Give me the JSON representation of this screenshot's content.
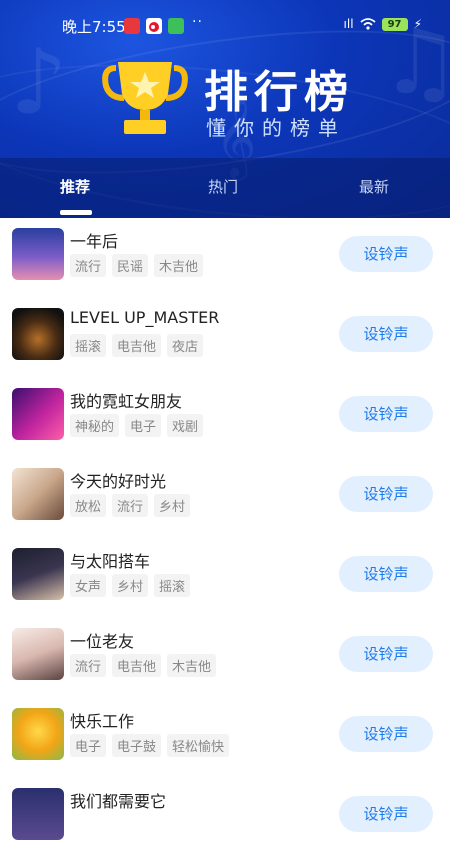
{
  "status_bar": {
    "time": "晚上7:55",
    "dots": "··",
    "signal": "ıll",
    "battery": "97",
    "charging": "⚡"
  },
  "header": {
    "title": "排行榜",
    "subtitle": "懂你的榜单"
  },
  "tabs": [
    {
      "label": "推荐"
    },
    {
      "label": "热门"
    },
    {
      "label": "最新"
    }
  ],
  "items": [
    {
      "title": "一年后",
      "tags": [
        "流行",
        "民谣",
        "木吉他"
      ],
      "button": "设铃声"
    },
    {
      "title": "LEVEL UP_MASTER",
      "tags": [
        "摇滚",
        "电吉他",
        "夜店"
      ],
      "button": "设铃声"
    },
    {
      "title": "我的霓虹女朋友",
      "tags": [
        "神秘的",
        "电子",
        "戏剧"
      ],
      "button": "设铃声"
    },
    {
      "title": "今天的好时光",
      "tags": [
        "放松",
        "流行",
        "乡村"
      ],
      "button": "设铃声"
    },
    {
      "title": "与太阳搭车",
      "tags": [
        "女声",
        "乡村",
        "摇滚"
      ],
      "button": "设铃声"
    },
    {
      "title": "一位老友",
      "tags": [
        "流行",
        "电吉他",
        "木吉他"
      ],
      "button": "设铃声"
    },
    {
      "title": "快乐工作",
      "tags": [
        "电子",
        "电子鼓",
        "轻松愉快"
      ],
      "button": "设铃声"
    },
    {
      "title": "我们都需要它",
      "tags": [],
      "button": "设铃声"
    }
  ],
  "colors": {
    "header_blue": "#0c36b8",
    "button_bg": "#e1efff",
    "button_text": "#1e7bea"
  }
}
